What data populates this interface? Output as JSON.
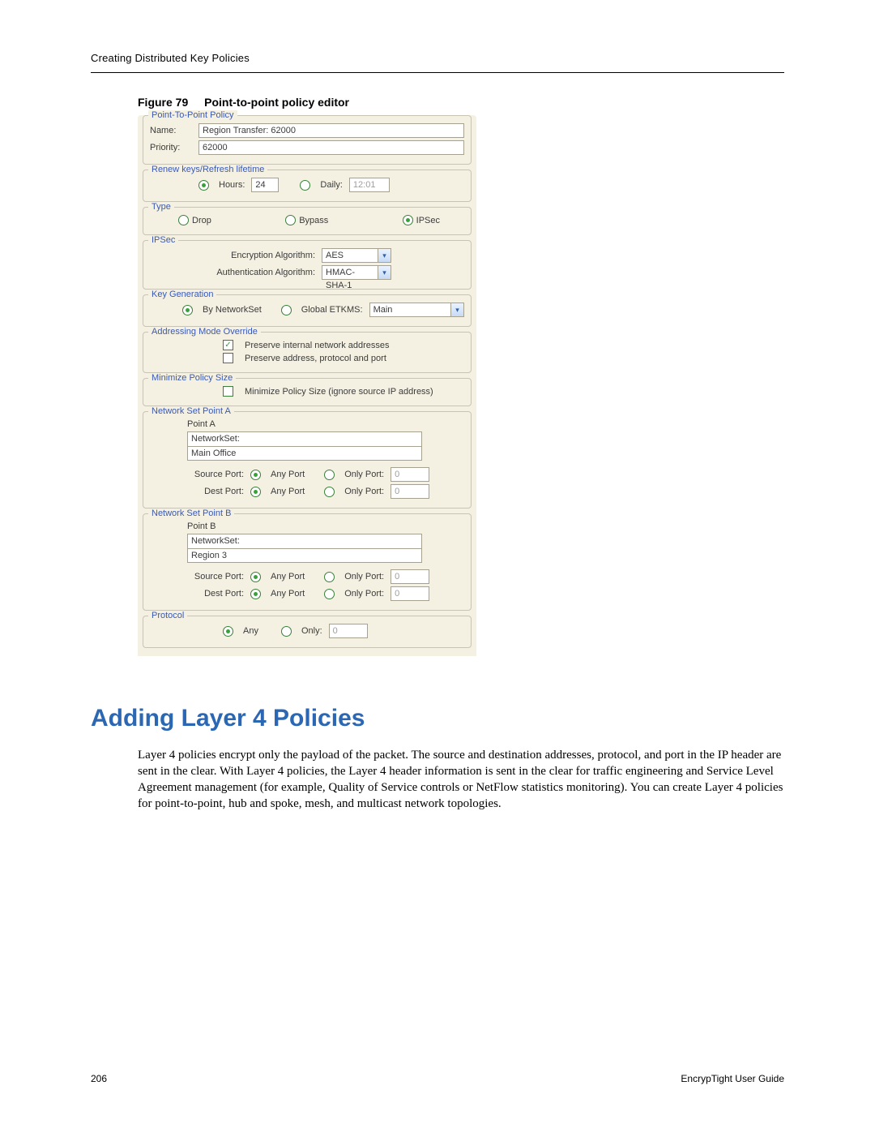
{
  "header": "Creating Distributed Key Policies",
  "figure": {
    "num": "Figure 79",
    "caption": "Point-to-point policy editor"
  },
  "editor": {
    "top_legend": "Point-To-Point Policy",
    "name_lbl": "Name:",
    "name_val": "Region Transfer: 62000",
    "priority_lbl": "Priority:",
    "priority_val": "62000",
    "renew": {
      "legend": "Renew keys/Refresh lifetime",
      "hours_lbl": "Hours:",
      "hours_val": "24",
      "daily_lbl": "Daily:",
      "daily_val": "12:01"
    },
    "type": {
      "legend": "Type",
      "drop": "Drop",
      "bypass": "Bypass",
      "ipsec": "IPSec"
    },
    "ipsec": {
      "legend": "IPSec",
      "enc_lbl": "Encryption Algorithm:",
      "enc_val": "AES",
      "auth_lbl": "Authentication Algorithm:",
      "auth_val": "HMAC-SHA-1"
    },
    "keygen": {
      "legend": "Key Generation",
      "byns": "By NetworkSet",
      "global": "Global ETKMS:",
      "global_val": "Main"
    },
    "addr": {
      "legend": "Addressing Mode Override",
      "pres1": "Preserve internal network addresses",
      "pres2": "Preserve address, protocol and port"
    },
    "min": {
      "legend": "Minimize Policy Size",
      "opt": "Minimize Policy Size  (ignore source IP address)"
    },
    "nspa": {
      "legend": "Network Set Point A",
      "point": "Point A",
      "ns_lbl": "NetworkSet:",
      "ns_val": "Main Office",
      "srcport_lbl": "Source Port:",
      "destport_lbl": "Dest Port:",
      "anyport": "Any Port",
      "onlyport": "Only Port:",
      "zero": "0"
    },
    "nspb": {
      "legend": "Network Set Point B",
      "point": "Point B",
      "ns_lbl": "NetworkSet:",
      "ns_val": "Region 3",
      "srcport_lbl": "Source Port:",
      "destport_lbl": "Dest Port:",
      "anyport": "Any Port",
      "onlyport": "Only Port:",
      "zero": "0"
    },
    "proto": {
      "legend": "Protocol",
      "any": "Any",
      "only": "Only:",
      "zero": "0"
    }
  },
  "section_heading": "Adding Layer 4 Policies",
  "body": "Layer 4 policies encrypt only the payload of the packet. The source and destination addresses, protocol, and port in the IP header are sent in the clear. With Layer 4 policies, the Layer 4 header information is sent in the clear for traffic engineering and Service Level Agreement management (for example, Quality of Service controls or NetFlow statistics monitoring). You can create Layer 4 policies for point-to-point, hub and spoke, mesh, and multicast network topologies.",
  "footer": {
    "page": "206",
    "doc": "EncrypTight User Guide"
  }
}
